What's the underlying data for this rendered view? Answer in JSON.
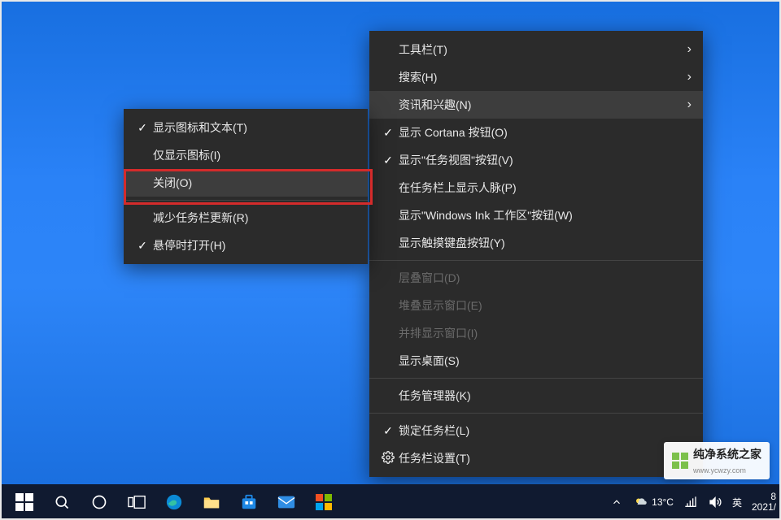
{
  "main_menu": {
    "items": [
      {
        "label": "工具栏(T)",
        "check": "",
        "arrow": true
      },
      {
        "label": "搜索(H)",
        "check": "",
        "arrow": true
      },
      {
        "label": "资讯和兴趣(N)",
        "check": "",
        "arrow": true,
        "highlight": true
      },
      {
        "label": "显示 Cortana 按钮(O)",
        "check": "✓"
      },
      {
        "label": "显示\"任务视图\"按钮(V)",
        "check": "✓"
      },
      {
        "label": "在任务栏上显示人脉(P)",
        "check": ""
      },
      {
        "label": "显示\"Windows Ink 工作区\"按钮(W)",
        "check": ""
      },
      {
        "label": "显示触摸键盘按钮(Y)",
        "check": ""
      },
      {
        "sep": true
      },
      {
        "label": "层叠窗口(D)",
        "check": "",
        "disabled": true
      },
      {
        "label": "堆叠显示窗口(E)",
        "check": "",
        "disabled": true
      },
      {
        "label": "并排显示窗口(I)",
        "check": "",
        "disabled": true
      },
      {
        "label": "显示桌面(S)",
        "check": ""
      },
      {
        "sep": true
      },
      {
        "label": "任务管理器(K)",
        "check": ""
      },
      {
        "sep": true
      },
      {
        "label": "锁定任务栏(L)",
        "check": "✓"
      },
      {
        "label": "任务栏设置(T)",
        "icon": "gear"
      }
    ]
  },
  "sub_menu": {
    "items": [
      {
        "label": "显示图标和文本(T)",
        "check": "✓"
      },
      {
        "label": "仅显示图标(I)",
        "check": ""
      },
      {
        "label": "关闭(O)",
        "check": "",
        "highlight": true,
        "boxed": true
      },
      {
        "sep": true
      },
      {
        "label": "减少任务栏更新(R)",
        "check": ""
      },
      {
        "label": "悬停时打开(H)",
        "check": "✓"
      }
    ]
  },
  "taskbar": {
    "weather_temp": "13°C",
    "ime": "英",
    "time": "8",
    "date": "2021/"
  },
  "watermark": {
    "text": "纯净系统之家",
    "sub": "www.ycwzy.com"
  }
}
